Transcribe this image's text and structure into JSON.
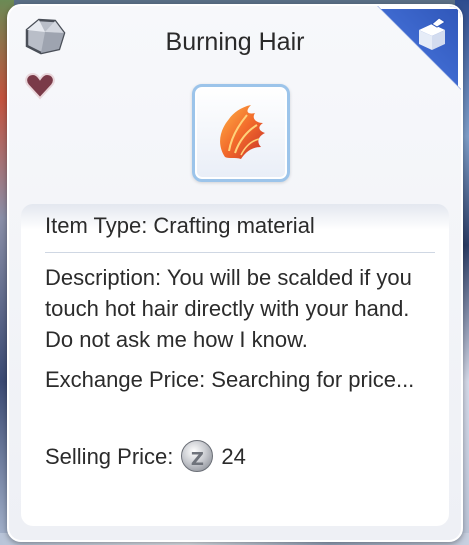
{
  "item": {
    "name": "Burning Hair",
    "icon": "burning-hair-icon"
  },
  "info": {
    "item_type": "Item Type: Crafting material",
    "description": "Description: You will be scalded if you touch hot hair directly with your hand. Do not ask me how I know.",
    "exchange_price": "Exchange Price: Searching for price...",
    "selling_label": "Selling Price:",
    "selling_value": "24",
    "currency_symbol": "Z"
  },
  "colors": {
    "ribbon": "#3e69cf",
    "frame_border": "#9cc4ea",
    "heart": "#7a3a48"
  }
}
